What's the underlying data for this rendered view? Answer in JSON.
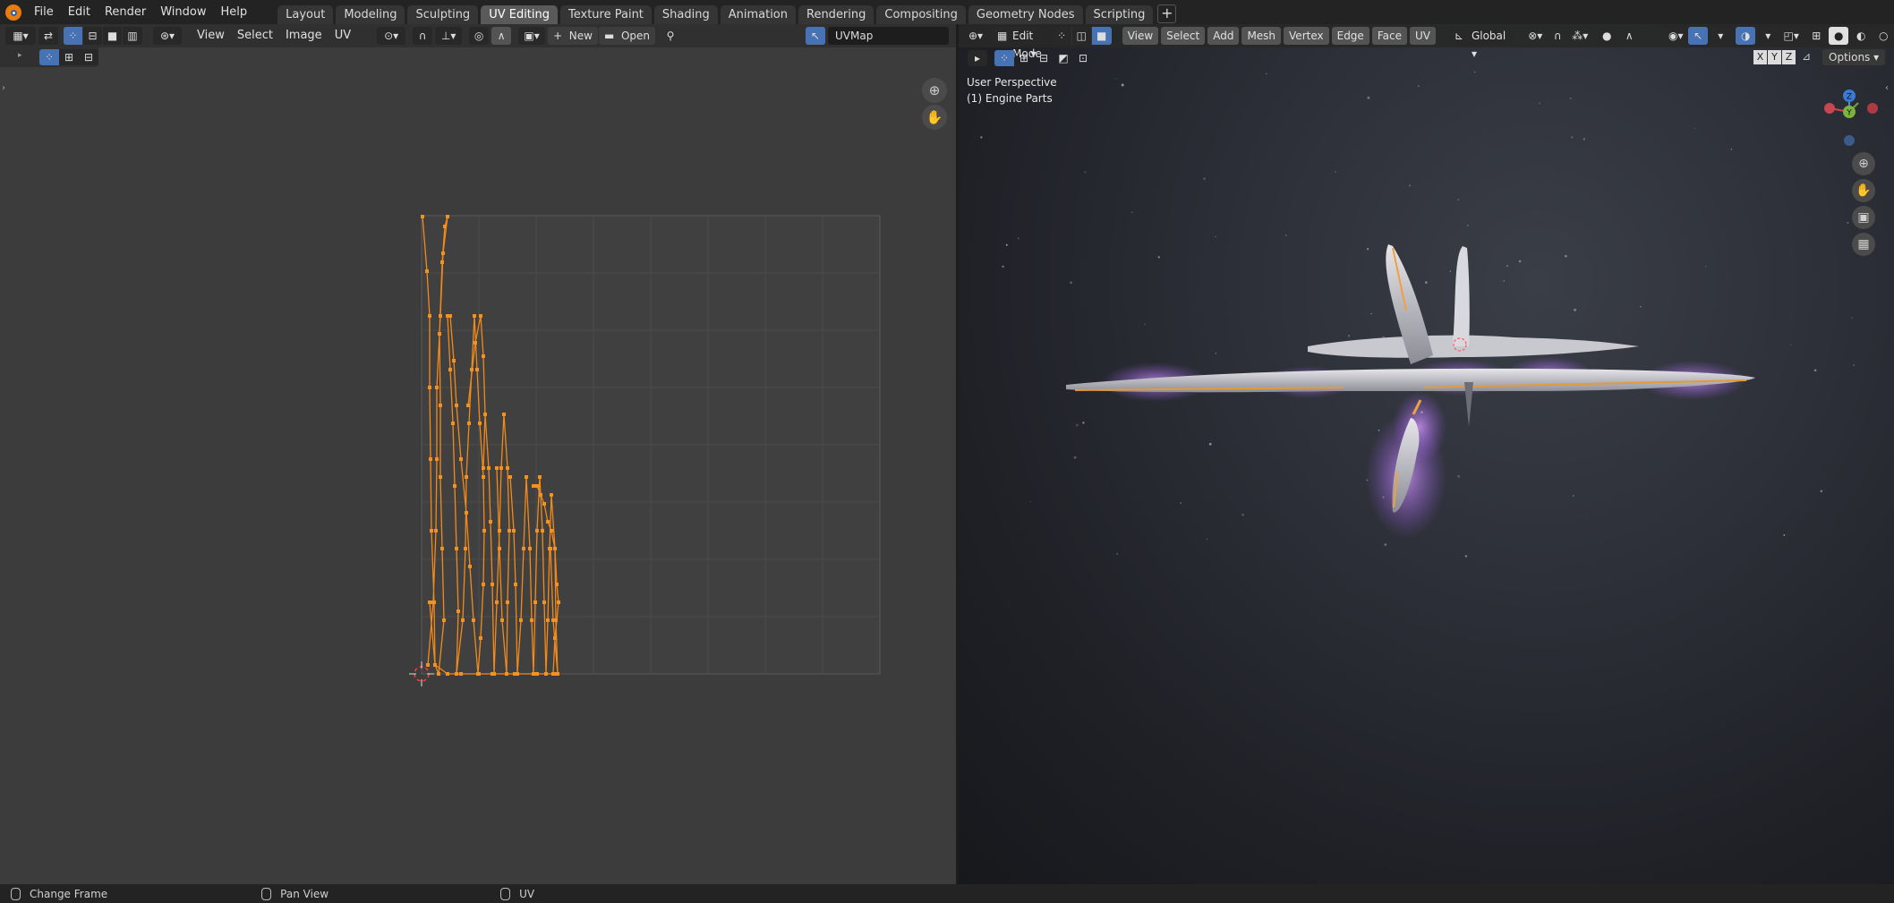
{
  "topbar": {
    "menus": [
      "File",
      "Edit",
      "Render",
      "Window",
      "Help"
    ],
    "tabs": [
      "Layout",
      "Modeling",
      "Sculpting",
      "UV Editing",
      "Texture Paint",
      "Shading",
      "Animation",
      "Rendering",
      "Compositing",
      "Geometry Nodes",
      "Scripting"
    ],
    "active_tab": "UV Editing",
    "add_tab_symbol": "+"
  },
  "uv_editor": {
    "menus": [
      "View",
      "Select",
      "Image",
      "UV"
    ],
    "new_label": "New",
    "open_label": "Open",
    "uv_map_name": "UVMap"
  },
  "viewport": {
    "mode": "Edit Mode",
    "menus": [
      "View",
      "Select",
      "Add",
      "Mesh",
      "Vertex",
      "Edge",
      "Face",
      "UV"
    ],
    "transform_orientation": "Global",
    "perspective_label": "User Perspective",
    "object_label": "(1) Engine Parts",
    "axis_toggles": [
      "X",
      "Y",
      "Z"
    ],
    "options_label": "Options",
    "gizmo": {
      "z": "Z",
      "y": "Y"
    }
  },
  "statusbar": {
    "items": [
      "Change Frame",
      "Pan View",
      "UV"
    ]
  },
  "colors": {
    "accent": "#4772b3",
    "uv_wire": "#f28a1a",
    "active_tab": "#5a5a5a"
  }
}
